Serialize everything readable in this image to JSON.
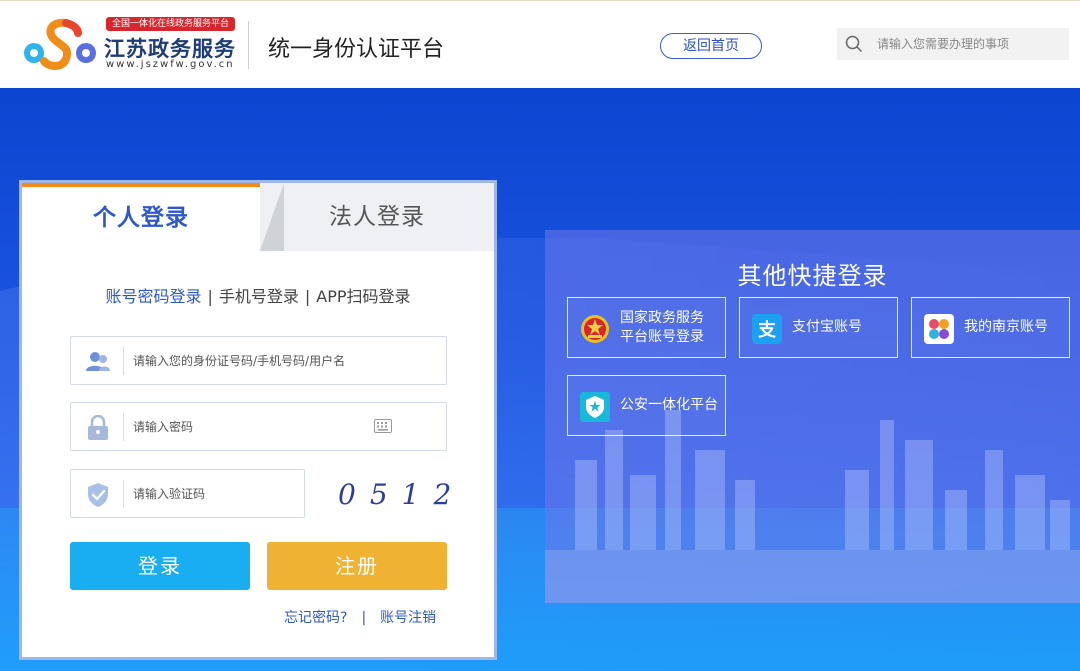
{
  "header": {
    "badge_text": "全国一体化在线政务服务平台",
    "logo_name": "江苏政务服务",
    "logo_url": "www.jszwfw.gov.cn",
    "platform_title": "统一身份认证平台",
    "home_button": "返回首页",
    "search_placeholder": "请输入您需要办理的事项"
  },
  "login": {
    "tabs": [
      {
        "label": "个人登录",
        "active": true
      },
      {
        "label": "法人登录",
        "active": false
      }
    ],
    "methods": [
      {
        "label": "账号密码登录",
        "active": true
      },
      {
        "label": "手机号登录",
        "active": false
      },
      {
        "label": "APP扫码登录",
        "active": false
      }
    ],
    "separator": "|",
    "account_placeholder": "请输入您的身份证号码/手机号码/用户名",
    "password_placeholder": "请输入密码",
    "captcha_placeholder": "请输入验证码",
    "captcha_code": "0512",
    "login_button": "登录",
    "register_button": "注册",
    "forgot_link": "忘记密码?",
    "link_separator": "|",
    "cancel_link": "账号注销"
  },
  "quick_login": {
    "title": "其他快捷登录",
    "options": [
      {
        "label": "国家政务服务\n平台账号登录",
        "icon": "national-emblem-icon"
      },
      {
        "label": "支付宝账号",
        "icon": "alipay-icon"
      },
      {
        "label": "我的南京账号",
        "icon": "my-nanjing-icon"
      },
      {
        "label": "公安一体化平台",
        "icon": "police-badge-icon"
      }
    ]
  },
  "colors": {
    "primary_blue": "#2e58c8",
    "tab_accent": "#f08c1a",
    "login_button": "#19aef2",
    "register_button": "#efb232",
    "hero_blue": "#1d55e0"
  }
}
